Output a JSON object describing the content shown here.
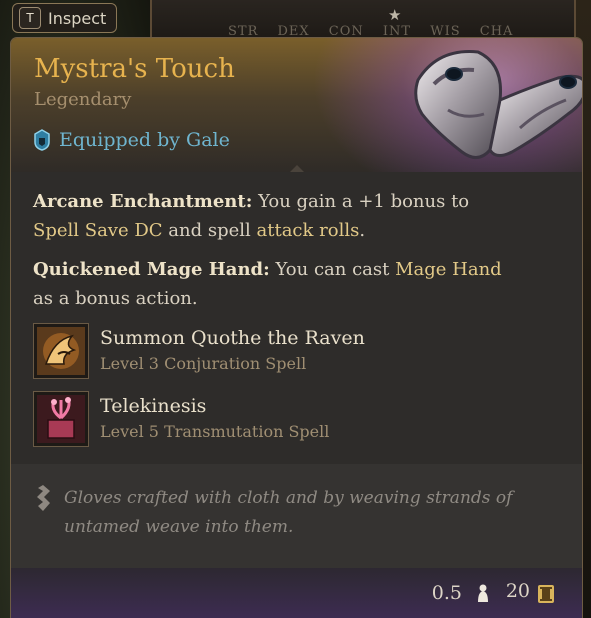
{
  "background": {
    "stats_header": "STR  DEX  CON  INT  WIS  CHA"
  },
  "inspect": {
    "key": "T",
    "label": "Inspect"
  },
  "item": {
    "name": "Mystra's Touch",
    "rarity": "Legendary",
    "equipped_by": "Equipped by Gale",
    "icon": "gloves-item-icon",
    "rarity_color": "#e7b34e"
  },
  "properties": [
    {
      "title": "Arcane Enchantment:",
      "text_1": " You gain a +1 bonus to ",
      "hl_1": "Spell Save DC",
      "text_2": " and spell ",
      "hl_2": "attack rolls",
      "text_3": "."
    },
    {
      "title": "Quickened Mage Hand:",
      "text_1": " You can cast ",
      "hl_1": "Mage Hand",
      "text_2": " as a bonus action."
    }
  ],
  "spells": [
    {
      "name": "Summon Quothe the Raven",
      "sub": "Level 3 Conjuration Spell",
      "icon": "raven-spell-icon"
    },
    {
      "name": "Telekinesis",
      "sub": "Level 5 Transmutation Spell",
      "icon": "telekinesis-spell-icon"
    }
  ],
  "description": "Gloves crafted with cloth and by weaving strands of untamed weave into them.",
  "footer": {
    "weight": "0.5",
    "price": "20"
  },
  "colors": {
    "equip_text": "#6fb5cf",
    "highlight_text": "#e2c988"
  }
}
